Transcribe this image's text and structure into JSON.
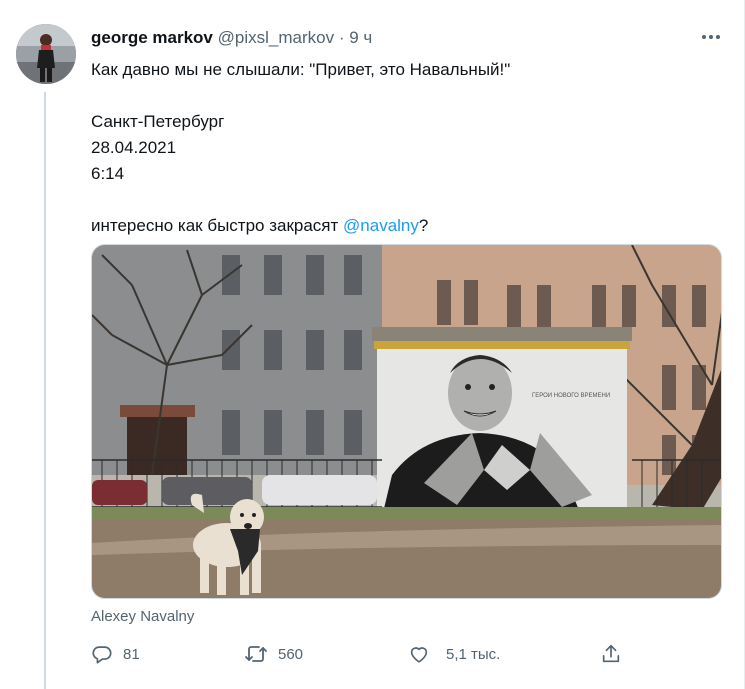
{
  "tweet": {
    "author_name": "george markov",
    "handle": "@pixsl_markov",
    "separator": "·",
    "time": "9 ч",
    "text_lines": {
      "line1": "Как давно мы не слышали: \"Привет, это Навальный!\"",
      "line2": "Санкт-Петербург",
      "line3": "28.04.2021",
      "line4": "6:14",
      "line5_before": "интересно как быстро закрасят ",
      "line5_mention": "@navalny",
      "line5_after": "?"
    },
    "mural_text": "ГЕРОИ НОВОГО ВРЕМЕНИ",
    "media_caption": "Alexey Navalny"
  },
  "actions": {
    "reply_count": "81",
    "retweet_count": "560",
    "like_count": "5,1 тыс."
  },
  "icons": {
    "more": "more-horizontal-icon",
    "reply": "reply-icon",
    "retweet": "retweet-icon",
    "like": "heart-icon",
    "share": "share-icon"
  },
  "colors": {
    "text": "#0f1419",
    "muted": "#536471",
    "link": "#1d9bf0",
    "thread_line": "#cfd9de"
  }
}
